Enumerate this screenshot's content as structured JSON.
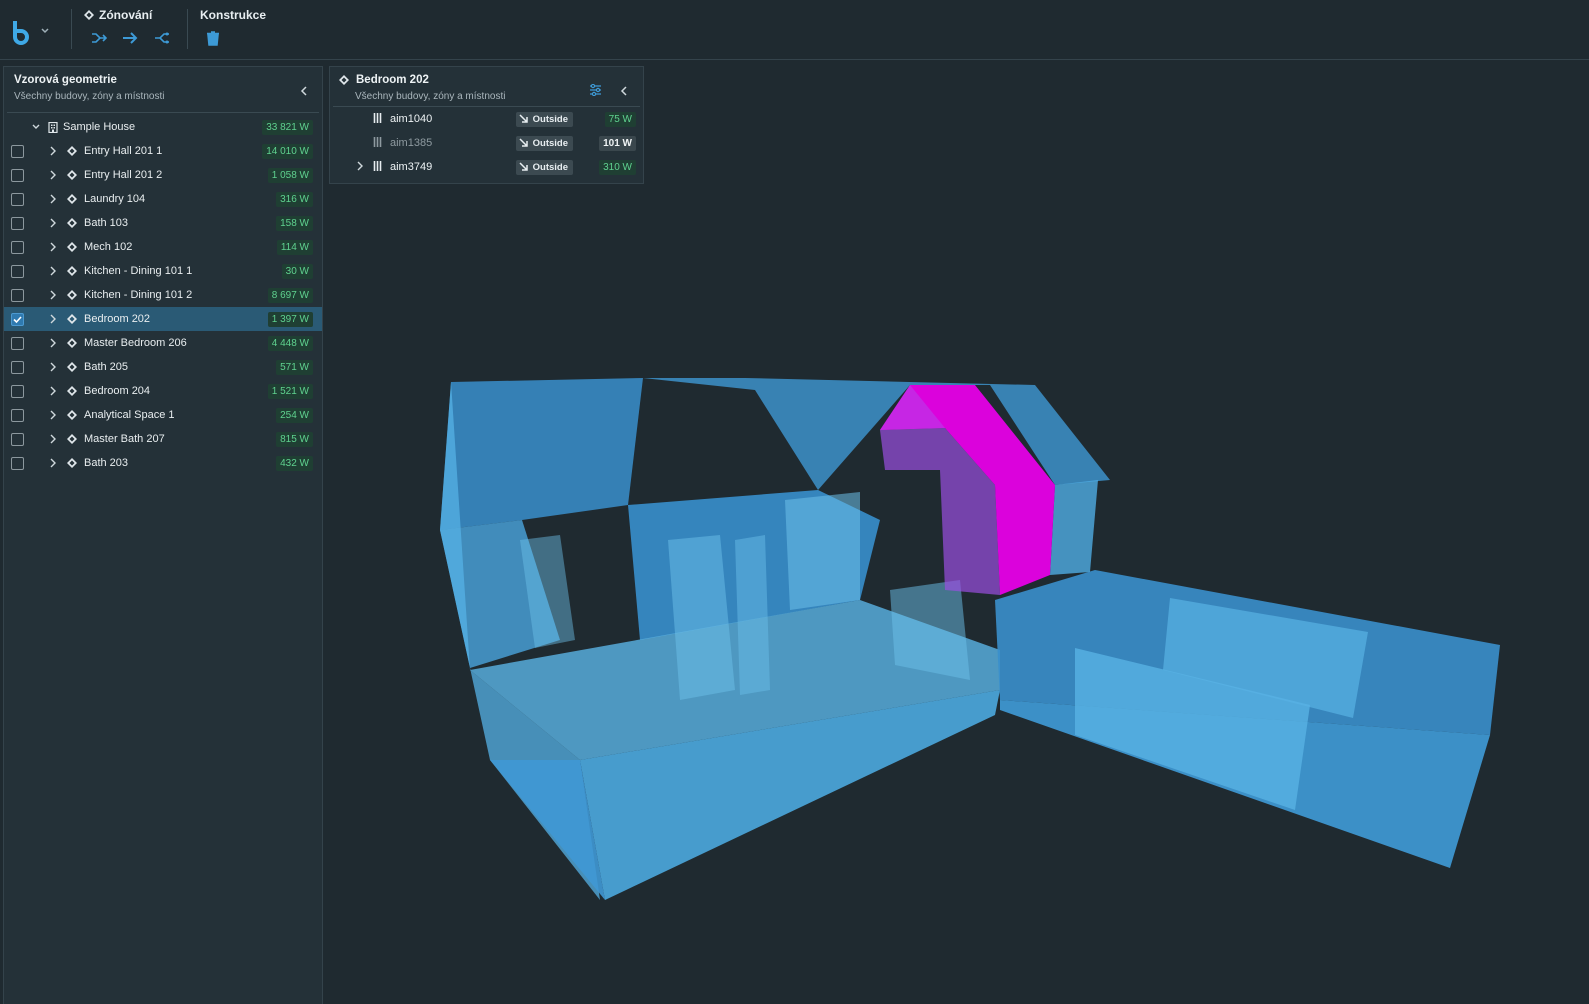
{
  "toolbar": {
    "logo_icon": "app-logo-icon",
    "zoning": {
      "title": "Zónování",
      "icons": [
        "merge-zones-icon",
        "arrow-right-icon",
        "split-icon"
      ]
    },
    "construction": {
      "title": "Konstrukce",
      "icons": [
        "trash-icon"
      ]
    }
  },
  "left_panel": {
    "title": "Vzorová geometrie",
    "subtitle": "Všechny budovy, zóny a místnosti",
    "root": {
      "label": "Sample House",
      "watts": "33 821 W"
    },
    "items": [
      {
        "label": "Entry Hall 201 1",
        "watts": "14 010 W",
        "checked": false
      },
      {
        "label": "Entry Hall 201 2",
        "watts": "1 058 W",
        "checked": false
      },
      {
        "label": "Laundry 104",
        "watts": "316 W",
        "checked": false
      },
      {
        "label": "Bath 103",
        "watts": "158 W",
        "checked": false
      },
      {
        "label": "Mech 102",
        "watts": "114 W",
        "checked": false
      },
      {
        "label": "Kitchen - Dining 101 1",
        "watts": "30 W",
        "checked": false
      },
      {
        "label": "Kitchen - Dining 101 2",
        "watts": "8 697 W",
        "checked": false
      },
      {
        "label": "Bedroom 202",
        "watts": "1 397 W",
        "checked": true
      },
      {
        "label": "Master Bedroom 206",
        "watts": "4 448 W",
        "checked": false
      },
      {
        "label": "Bath 205",
        "watts": "571 W",
        "checked": false
      },
      {
        "label": "Bedroom 204",
        "watts": "1 521 W",
        "checked": false
      },
      {
        "label": "Analytical Space 1",
        "watts": "254 W",
        "checked": false
      },
      {
        "label": "Master Bath 207",
        "watts": "815 W",
        "checked": false
      },
      {
        "label": "Bath 203",
        "watts": "432 W",
        "checked": false
      }
    ]
  },
  "detail_panel": {
    "title": "Bedroom 202",
    "subtitle": "Všechny budovy, zóny a místnosti",
    "rows": [
      {
        "name": "aim1040",
        "badge": "Outside",
        "watts": "75 W"
      },
      {
        "name": "aim1385",
        "badge": "Outside",
        "watts": "101 W"
      },
      {
        "name": "aim3749",
        "badge": "Outside",
        "watts": "310 W"
      }
    ]
  },
  "colors": {
    "background": "#1f2a30",
    "panel": "#243138",
    "selected_row": "#2a5a75",
    "accent": "#3d9ad6",
    "highlight_zone": "#e600e6",
    "building": "#4aa8e0",
    "watt_text": "#5fd28f"
  }
}
